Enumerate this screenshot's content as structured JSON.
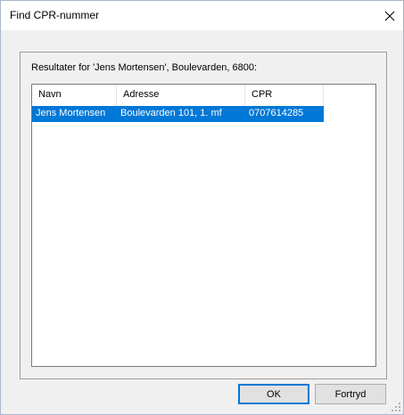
{
  "dialog": {
    "title": "Find CPR-nummer",
    "caption": "Resultater for 'Jens Mortensen', Boulevarden, 6800:"
  },
  "table": {
    "columns": [
      "Navn",
      "Adresse",
      "CPR"
    ],
    "rows": [
      {
        "navn": "Jens Mortensen",
        "adresse": "Boulevarden 101, 1. mf",
        "cpr": "0707614285",
        "selected": true
      }
    ]
  },
  "buttons": {
    "ok": "OK",
    "cancel": "Fortryd"
  },
  "colors": {
    "selection": "#0078d7",
    "default_button_border": "#0078d7"
  },
  "icons": {
    "close": "close-icon",
    "grip": "resize-grip-icon"
  }
}
